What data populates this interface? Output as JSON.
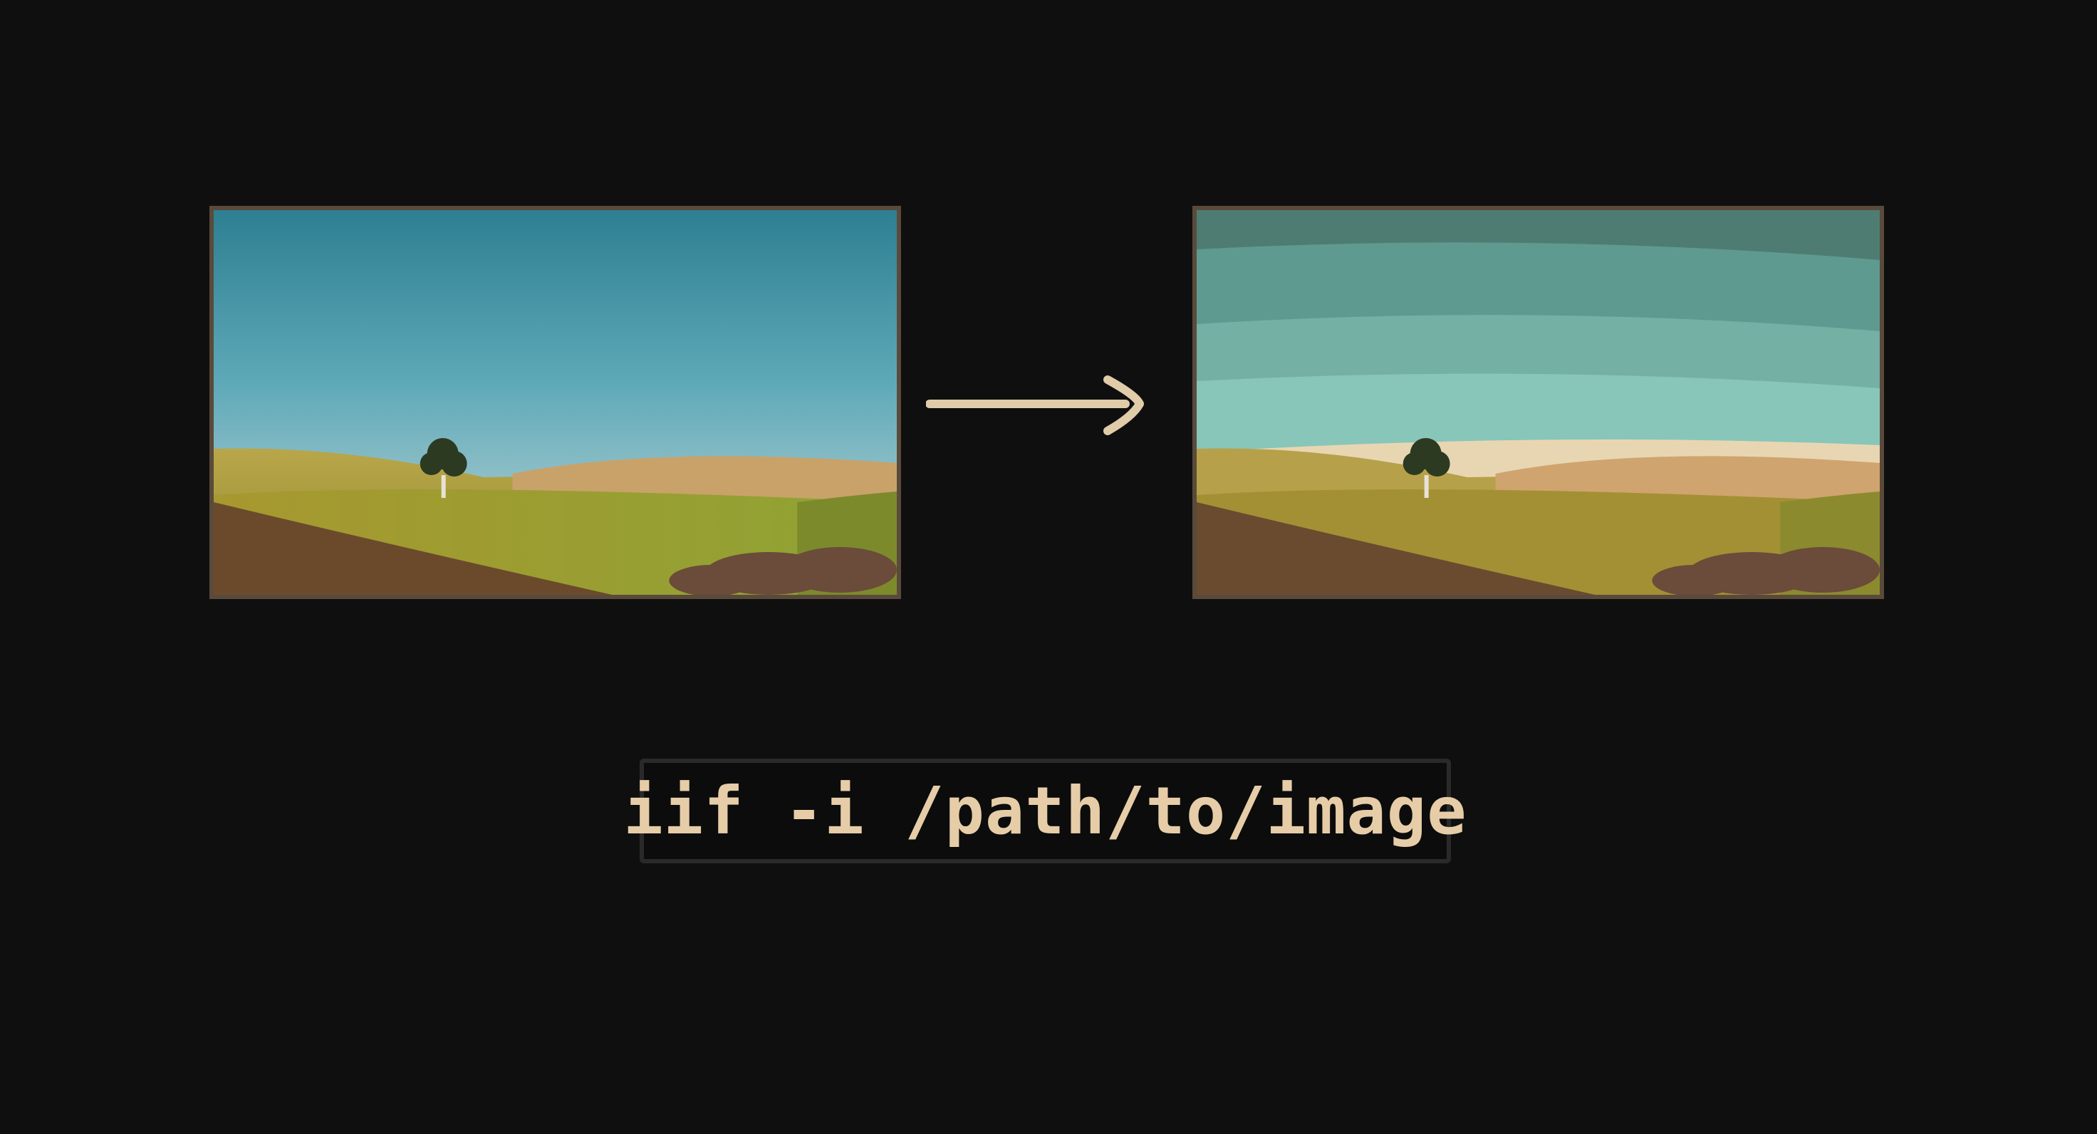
{
  "command": {
    "text": "iif -i /path/to/image"
  },
  "colors": {
    "background": "#0f0f0f",
    "frame_border": "#5a4a3b",
    "arrow": "#e1ccaa",
    "command_text": "#e6cda8",
    "command_box_border": "#2a2a2a"
  },
  "images": [
    {
      "role": "original",
      "description_icon": "landscape-photo-icon"
    },
    {
      "role": "processed",
      "description_icon": "landscape-photo-icon"
    }
  ]
}
